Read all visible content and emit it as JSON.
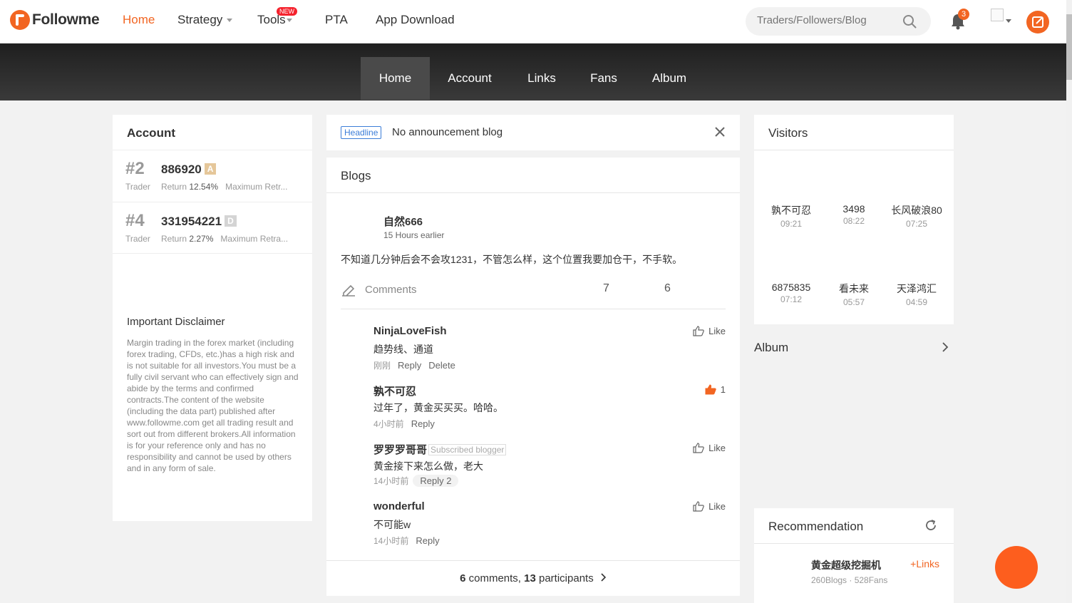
{
  "brand": {
    "name": "Followme",
    "accent": "#f26522"
  },
  "nav": {
    "home": "Home",
    "strategy": "Strategy",
    "tools": "Tools",
    "tools_badge": "NEW",
    "pta": "PTA",
    "app_download": "App Download"
  },
  "search": {
    "placeholder": "Traders/Followers/Blog"
  },
  "notifications": {
    "count": "3"
  },
  "subnav": {
    "home": "Home",
    "account": "Account",
    "links": "Links",
    "fans": "Fans",
    "album": "Album"
  },
  "account": {
    "title": "Account",
    "rows": [
      {
        "rank": "#2",
        "role": "Trader",
        "number": "886920",
        "grade": "A",
        "grade_color": "#e5c79a",
        "return_label": "Return",
        "return_value": "12.54%",
        "drawdown_label": "Maximum Retr..."
      },
      {
        "rank": "#4",
        "role": "Trader",
        "number": "331954221",
        "grade": "D",
        "grade_color": "#d4d4d4",
        "return_label": "Return",
        "return_value": "2.27%",
        "drawdown_label": "Maximum Retra..."
      }
    ],
    "disclaimer_title": "Important Disclaimer",
    "disclaimer_text": "Margin trading in the forex market (including forex trading, CFDs, etc.)has a high risk and is not suitable for all investors.You must be a fully civil servant who can effectively sign and abide by the terms and confirmed contracts.The content of the website (including the data part) published after www.followme.com get all trading result and sort out from different brokers.All information is for your reference only and has no responsibility and cannot be used by others and in any form of sale."
  },
  "headline": {
    "tag": "Headline",
    "text": "No announcement blog"
  },
  "blogs": {
    "title": "Blogs",
    "post": {
      "author": "自然666",
      "time": "15 Hours earlier",
      "body": "不知道几分钟后会不会攻1231，不管怎么样，这个位置我要加仓干，不手软。",
      "comments_label": "Comments",
      "count_a": "7",
      "count_b": "6"
    },
    "comments": [
      {
        "author": "NinjaLoveFish",
        "tag": "",
        "body": "趋势线、通道",
        "time": "刚刚",
        "reply": "Reply",
        "delete": "Delete",
        "like": "Like",
        "liked": false
      },
      {
        "author": "孰不可忍",
        "tag": "",
        "body": "过年了，黄金买买买。哈哈。",
        "time": "4小时前",
        "reply": "Reply",
        "delete": "",
        "like": "1",
        "liked": true
      },
      {
        "author": "罗罗罗哥哥",
        "tag": "Subscribed blogger",
        "body": "黄金接下来怎么做，老大",
        "time": "14小时前",
        "reply": "Reply 2",
        "delete": "",
        "like": "Like",
        "liked": false
      },
      {
        "author": "wonderful",
        "tag": "",
        "body": "不可能w",
        "time": "14小时前",
        "reply": "Reply",
        "delete": "",
        "like": "Like",
        "liked": false
      }
    ],
    "footer": {
      "comments_num": "6",
      "comments_word": "comments,",
      "participants_num": "13",
      "participants_word": "participants"
    }
  },
  "visitors": {
    "title": "Visitors",
    "list": [
      {
        "name": "孰不可忍",
        "time": "09:21"
      },
      {
        "name": "3498",
        "time": "08:22"
      },
      {
        "name": "长风破浪80",
        "time": "07:25"
      },
      {
        "name": "6875835",
        "time": "07:12"
      },
      {
        "name": "看未来",
        "time": "05:57"
      },
      {
        "name": "天泽鸿汇",
        "time": "04:59"
      }
    ]
  },
  "album": {
    "title": "Album"
  },
  "recommendation": {
    "title": "Recommendation",
    "item": {
      "name": "黄金超级挖掘机",
      "meta": "260Blogs · 528Fans",
      "link": "Links"
    }
  }
}
